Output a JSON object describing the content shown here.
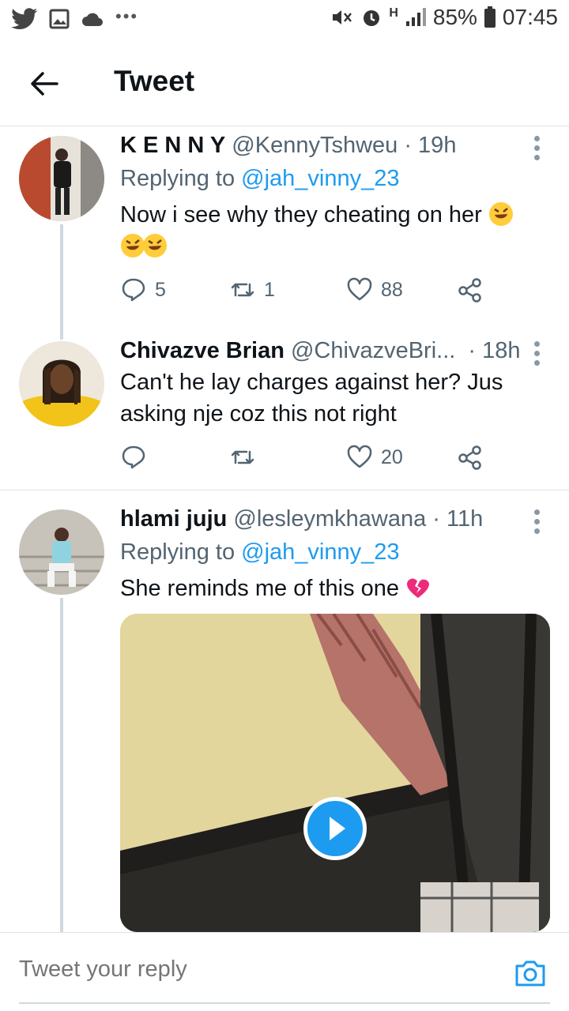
{
  "status_bar": {
    "battery_percent": "85%",
    "time": "07:45",
    "network_type": "H"
  },
  "header": {
    "title": "Tweet"
  },
  "tweets": [
    {
      "name": "K E N N Y",
      "handle": "@KennyTshweu",
      "time": "· 19h",
      "replying_label": "Replying to",
      "replying_to": "@jah_vinny_23",
      "text": "Now i see why they cheating on her",
      "reply_count": "5",
      "retweet_count": "1",
      "like_count": "88"
    },
    {
      "name": "Chivazve Brian",
      "handle": "@ChivazveBri...",
      "time": "· 18h",
      "text_line1": "Can't he lay charges against her? Jus",
      "text_line2": "asking nje coz this not right",
      "reply_count": "",
      "retweet_count": "",
      "like_count": "20"
    },
    {
      "name": "hlami juju",
      "handle": "@lesleymkhawana",
      "time": "· 11h",
      "replying_label": "Replying to",
      "replying_to": "@jah_vinny_23",
      "text": "She reminds me of this one"
    }
  ],
  "reply_bar": {
    "placeholder": "Tweet your reply"
  },
  "colors": {
    "accent": "#1d9bf0",
    "text_primary": "#0f1419",
    "text_secondary": "#536471"
  }
}
